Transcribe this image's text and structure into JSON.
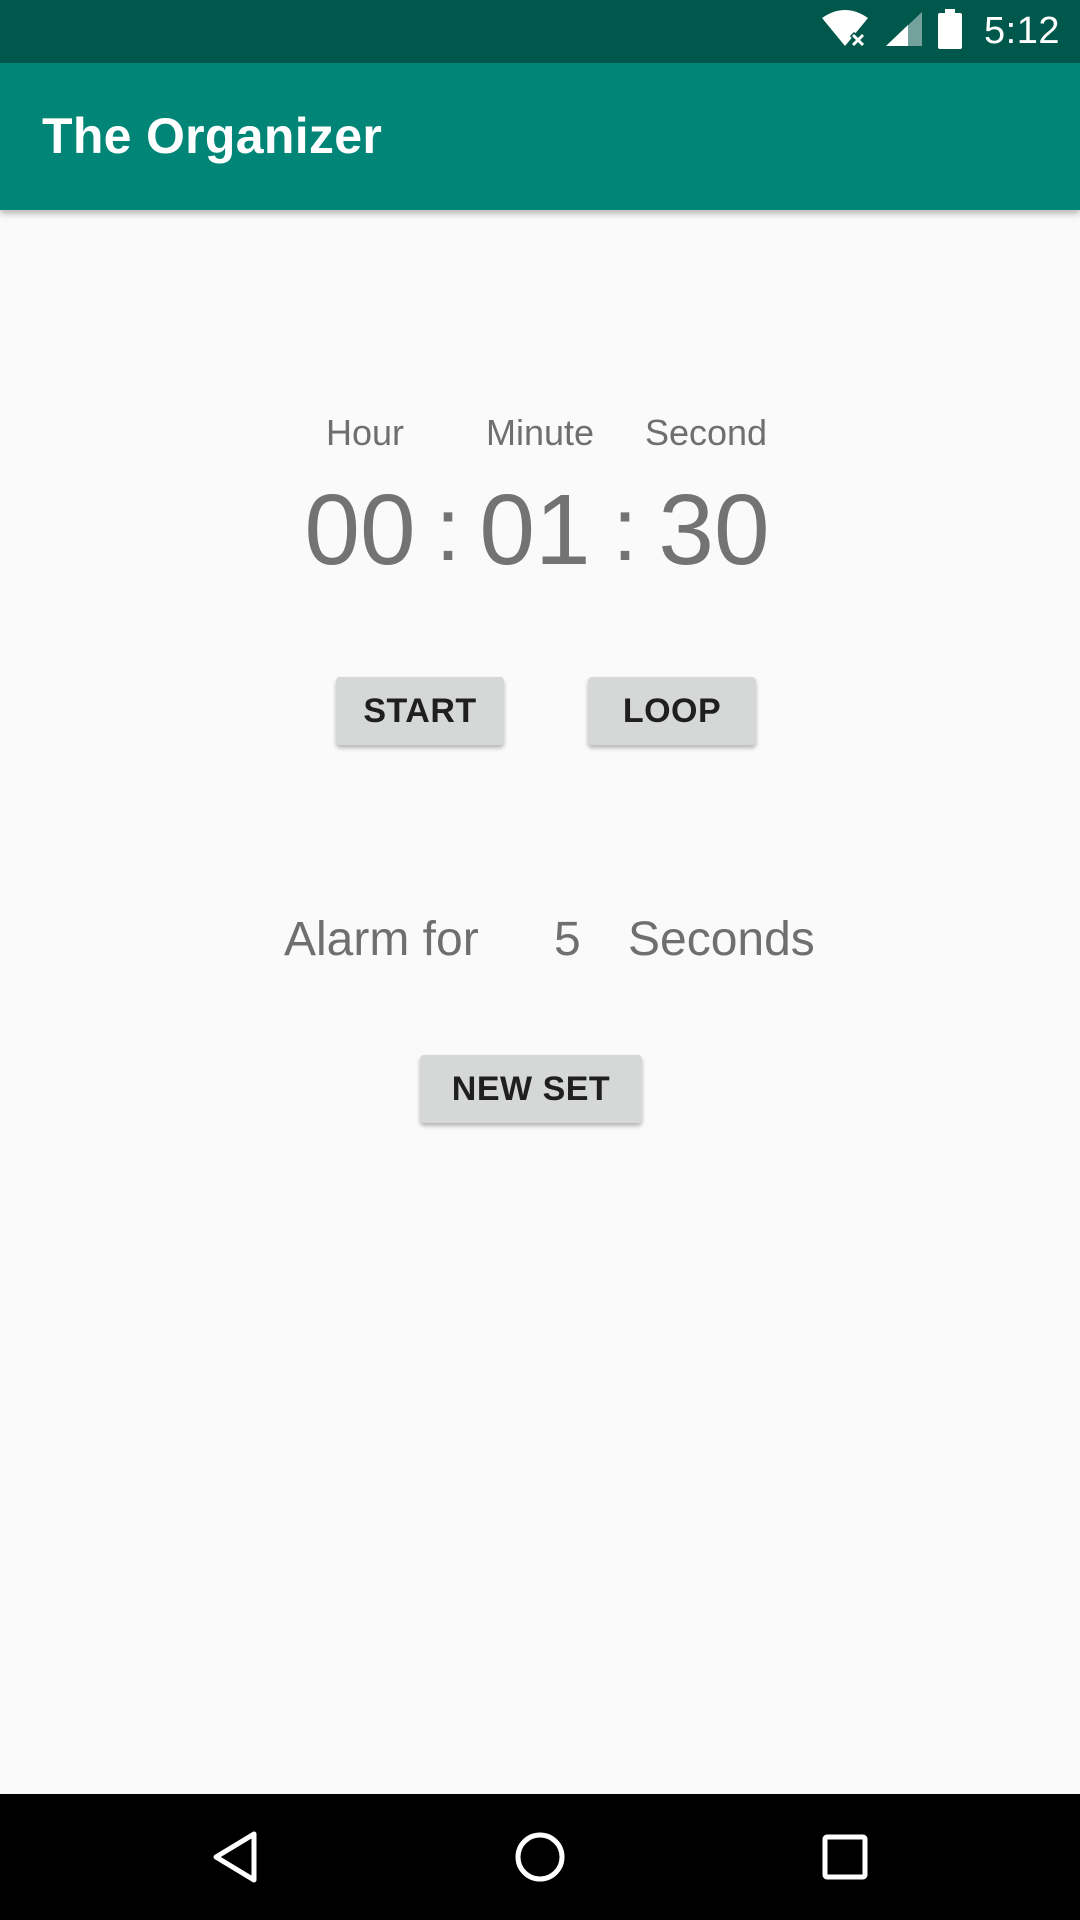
{
  "status_bar": {
    "time": "5:12",
    "icons": [
      "wifi-icon",
      "signal-icon",
      "battery-icon"
    ]
  },
  "app_bar": {
    "title": "The Organizer"
  },
  "timer": {
    "labels": {
      "hour": "Hour",
      "minute": "Minute",
      "second": "Second"
    },
    "values": {
      "hour": "00",
      "minute": "01",
      "second": "30"
    },
    "separator": ":"
  },
  "buttons": {
    "start": "START",
    "loop": "LOOP",
    "new_set": "NEW SET"
  },
  "alarm": {
    "prefix": "Alarm for",
    "value": "5",
    "unit": "Seconds"
  },
  "nav_bar": {
    "icons": [
      "back-icon",
      "home-icon",
      "recent-apps-icon"
    ]
  },
  "colors": {
    "status_bar": "#00574b",
    "app_bar": "#008577",
    "background": "#fafafa",
    "button": "#d6d7d7",
    "text_secondary": "#737373"
  }
}
